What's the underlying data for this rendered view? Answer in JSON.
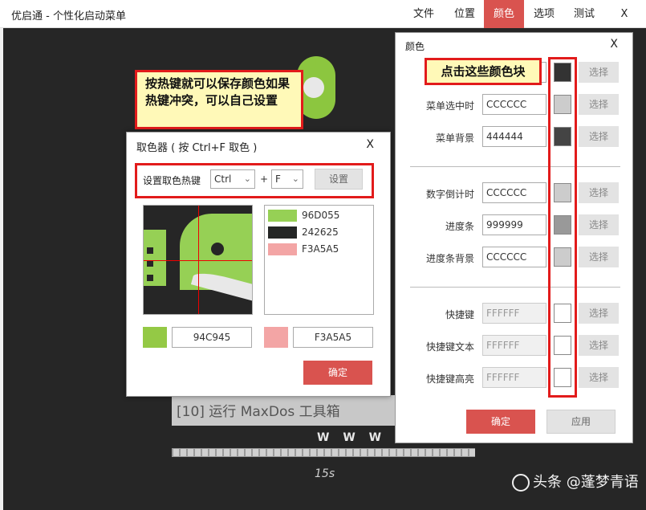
{
  "app": {
    "title": "优启通 - 个性化启动菜单",
    "menu": [
      {
        "label": "文件",
        "active": false
      },
      {
        "label": "位置",
        "active": false
      },
      {
        "label": "颜色",
        "active": true
      },
      {
        "label": "选项",
        "active": false
      },
      {
        "label": "测试",
        "active": false
      },
      {
        "label": "X",
        "active": false
      }
    ]
  },
  "background": {
    "menu_entry": "[10] 运行 MaxDos 工具箱",
    "url_text": "W W W . I T",
    "countdown": "15s",
    "watermark": "头条 @蓬梦青语"
  },
  "annotation": {
    "hotkey_note": "按热键就可以保存颜色如果热键冲突，可以自己设置",
    "swatch_note": "点击这些颜色块"
  },
  "picker": {
    "title": "取色器 ( 按 Ctrl+F 取色 )",
    "close": "X",
    "hotkey_label": "设置取色热键",
    "modifier": "Ctrl",
    "plus": "+",
    "key": "F",
    "set_button": "设置",
    "history": [
      {
        "hex": "96D055",
        "color": "#96D055"
      },
      {
        "hex": "242625",
        "color": "#242625"
      },
      {
        "hex": "F3A5A5",
        "color": "#F3A5A5"
      }
    ],
    "current_left": {
      "hex": "94C945",
      "color": "#94C945"
    },
    "current_right": {
      "hex": "F3A5A5",
      "color": "#F3A5A5"
    },
    "ok_button": "确定"
  },
  "panel": {
    "title": "颜色",
    "close": "X",
    "select_label": "选择",
    "rows": [
      {
        "label": "",
        "value": "",
        "color": "#333333",
        "disabled": false
      },
      {
        "label": "菜单选中时",
        "value": "CCCCCC",
        "color": "#CCCCCC",
        "disabled": false
      },
      {
        "label": "菜单背景",
        "value": "444444",
        "color": "#444444",
        "disabled": false
      },
      {
        "label": "数字倒计时",
        "value": "CCCCCC",
        "color": "#CCCCCC",
        "disabled": false
      },
      {
        "label": "进度条",
        "value": "999999",
        "color": "#999999",
        "disabled": false
      },
      {
        "label": "进度条背景",
        "value": "CCCCCC",
        "color": "#CCCCCC",
        "disabled": false
      },
      {
        "label": "快捷键",
        "value": "FFFFFF",
        "color": "#FFFFFF",
        "disabled": true
      },
      {
        "label": "快捷键文本",
        "value": "FFFFFF",
        "color": "#FFFFFF",
        "disabled": true
      },
      {
        "label": "快捷键高亮",
        "value": "FFFFFF",
        "color": "#FFFFFF",
        "disabled": true
      }
    ],
    "ok_button": "确定",
    "apply_button": "应用"
  },
  "colors": {
    "accent": "#D9534F",
    "highlight_border": "#E21B1B",
    "note_bg": "#FFF9B8",
    "logo_green": "#8CC63F"
  }
}
